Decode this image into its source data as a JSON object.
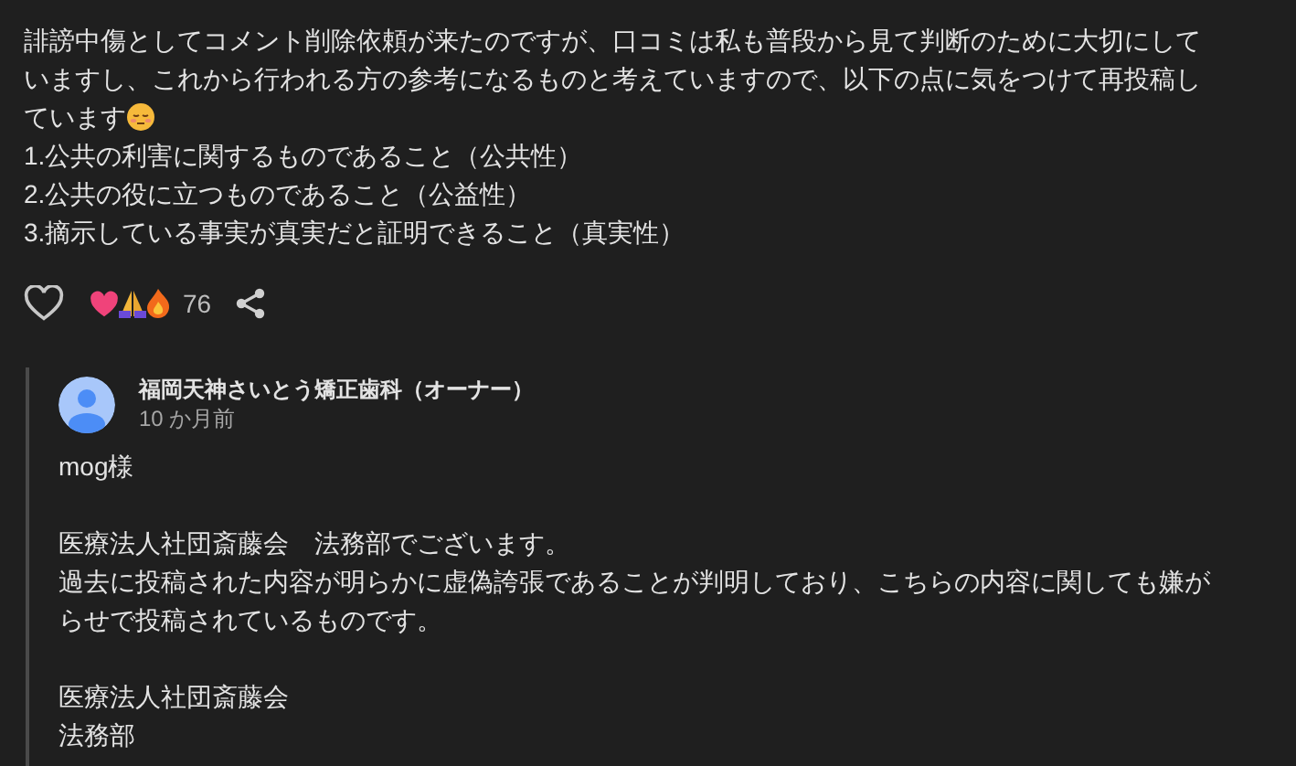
{
  "review": {
    "text_lines": [
      "誹謗中傷としてコメント削除依頼が来たのですが、口コミは私も普段から見て判断のために大切にして",
      "いますし、これから行われる方の参考になるものと考えていますので、以下の点に気をつけて再投稿し",
      "ています"
    ],
    "points": [
      "1.公共の利害に関するものであること（公共性）",
      "2.公共の役に立つものであること（公益性）",
      "3.摘示している事実が真実だと証明できること（真実性）"
    ]
  },
  "reactions": {
    "liked": false,
    "count": "76"
  },
  "reply": {
    "author": "福岡天神さいとう矯正歯科（オーナー）",
    "time": "10 か月前",
    "paragraphs": [
      [
        "mog様"
      ],
      [
        "医療法人社団斎藤会　法務部でございます。",
        "過去に投稿された内容が明らかに虚偽誇張であることが判明しており、こちらの内容に関しても嫌がらせで投稿されているものです。"
      ],
      [
        "医療法人社団斎藤会",
        "法務部"
      ]
    ]
  }
}
